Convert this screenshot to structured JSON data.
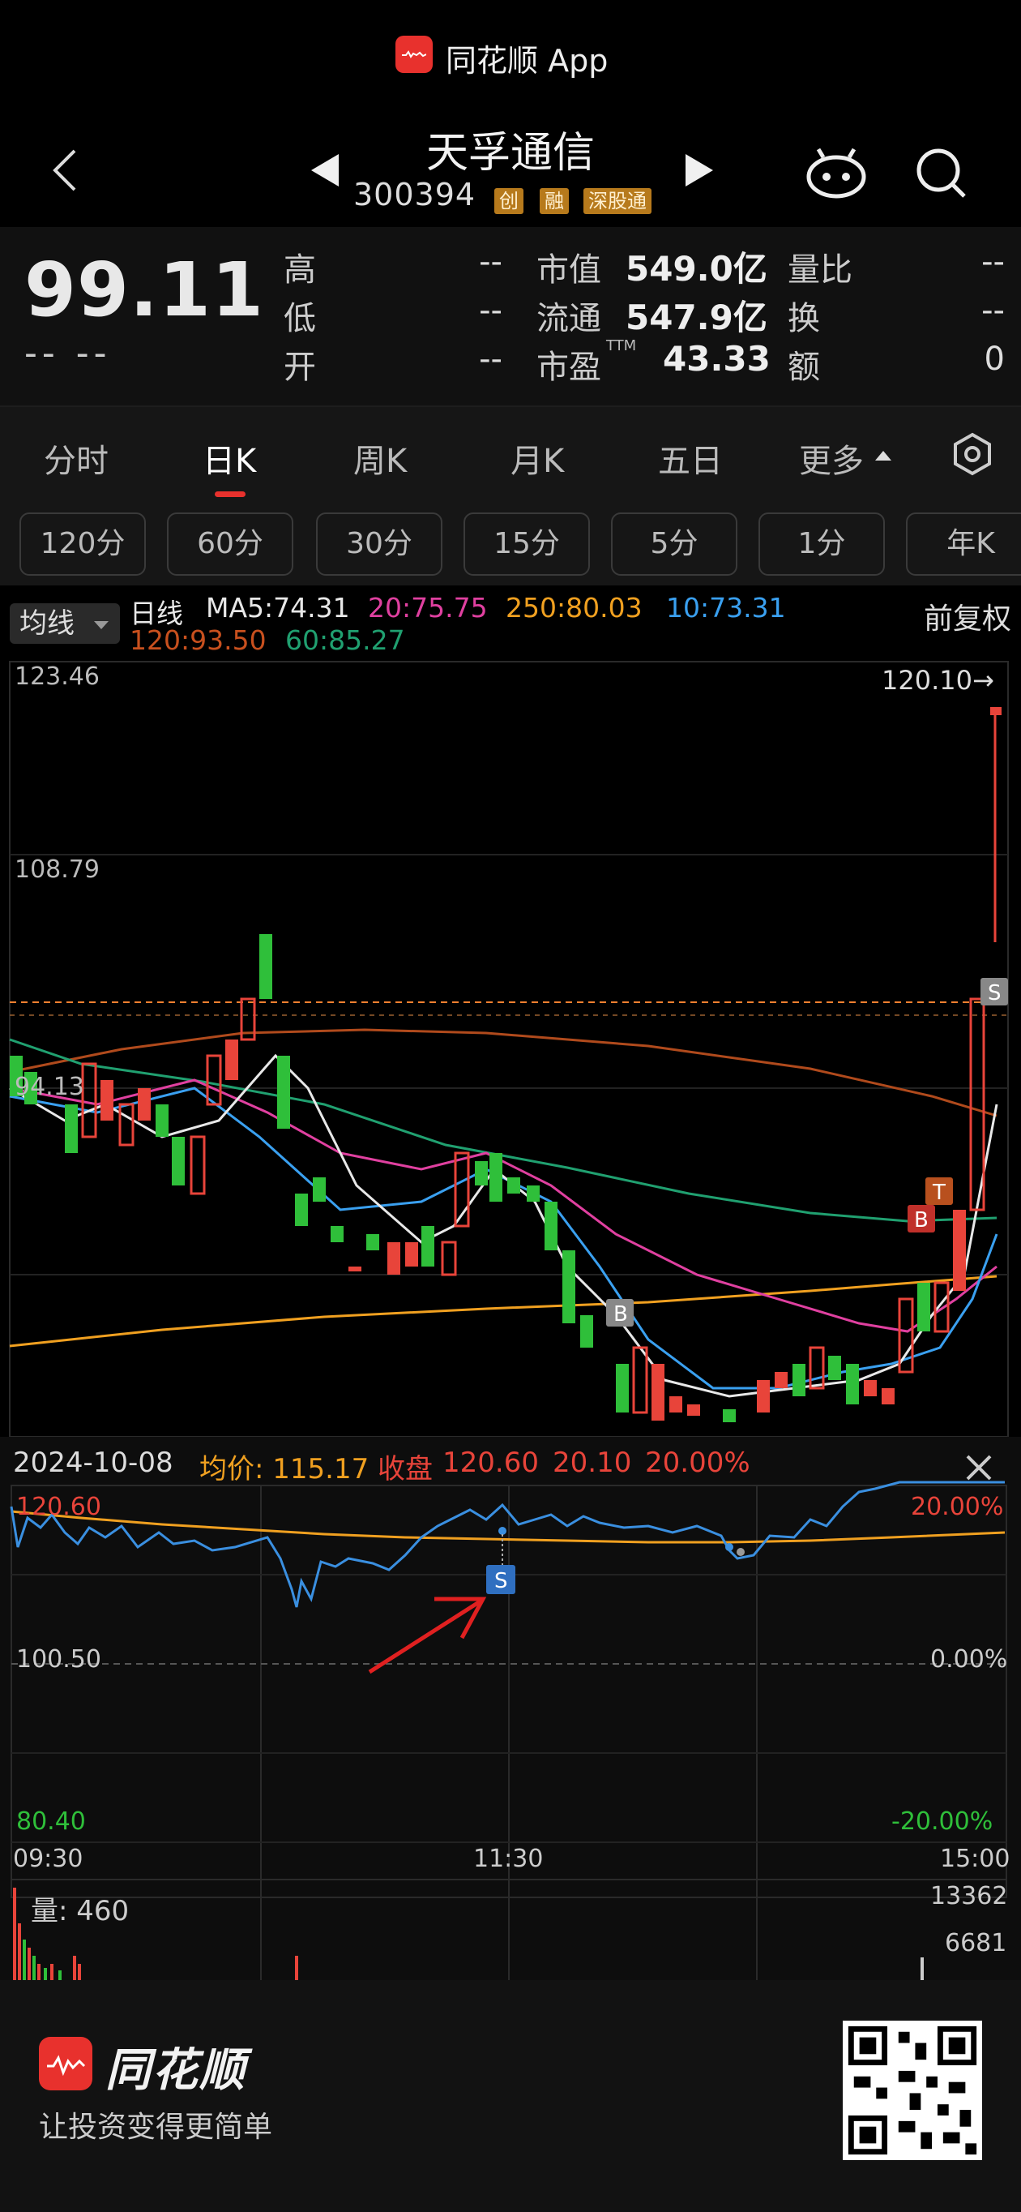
{
  "banner": {
    "app_title": "同花顺 App"
  },
  "header": {
    "stock_name": "天孚通信",
    "stock_code": "300394",
    "tags": [
      "创",
      "融",
      "深股通"
    ]
  },
  "quote": {
    "price": "99.11",
    "change": "-- --",
    "stats": [
      {
        "label": "高",
        "value": "--"
      },
      {
        "label": "低",
        "value": "--"
      },
      {
        "label": "开",
        "value": "--"
      },
      {
        "label": "市值",
        "value": "549.0亿"
      },
      {
        "label": "流通",
        "value": "547.9亿"
      },
      {
        "label": "市盈",
        "value": "43.33",
        "sup": "TTM"
      },
      {
        "label": "量比",
        "value": "--"
      },
      {
        "label": "换",
        "value": "--"
      },
      {
        "label": "额",
        "value": "0"
      }
    ]
  },
  "tabs": [
    "分时",
    "日K",
    "周K",
    "月K",
    "五日",
    "更多"
  ],
  "active_tab": "日K",
  "periods": [
    "120分",
    "60分",
    "30分",
    "15分",
    "5分",
    "1分",
    "年K"
  ],
  "kline": {
    "ma_select": "均线",
    "line_label": "日线",
    "fuquan": "前复权",
    "ma_values": [
      {
        "text": "MA5:74.31",
        "color": "#e8e8e8"
      },
      {
        "text": "20:75.75",
        "color": "#e040a0"
      },
      {
        "text": "250:80.03",
        "color": "#f0a020"
      },
      {
        "text": "10:73.31",
        "color": "#3aa0f0"
      },
      {
        "text": "120:93.50",
        "color": "#c8501e"
      },
      {
        "text": "60:85.27",
        "color": "#20a070"
      }
    ],
    "y_labels": [
      "123.46",
      "108.79",
      "94.13"
    ],
    "max_label": "120.10→",
    "markers": [
      "B",
      "B",
      "T",
      "S"
    ]
  },
  "intraday": {
    "date": "2024-10-08",
    "avg_label": "均价: 115.17",
    "close_label": "收盘",
    "close_value": "120.60",
    "change": "20.10",
    "change_pct": "20.00%",
    "y_left": [
      "120.60",
      "100.50",
      "80.40"
    ],
    "y_right": [
      "20.00%",
      "0.00%",
      "-20.00%"
    ],
    "x_labels": [
      "09:30",
      "11:30",
      "15:00"
    ],
    "volume_label": "量: 460",
    "volume_ticks": [
      "13362",
      "6681"
    ],
    "marker": "S"
  },
  "footer": {
    "brand": "同花顺",
    "slogan": "让投资变得更简单"
  },
  "colors": {
    "up": "#e8443a",
    "down": "#2fbf3a",
    "accent": "#e8312d",
    "intraday_line": "#3a8fe0",
    "avg_line": "#f0a020"
  }
}
